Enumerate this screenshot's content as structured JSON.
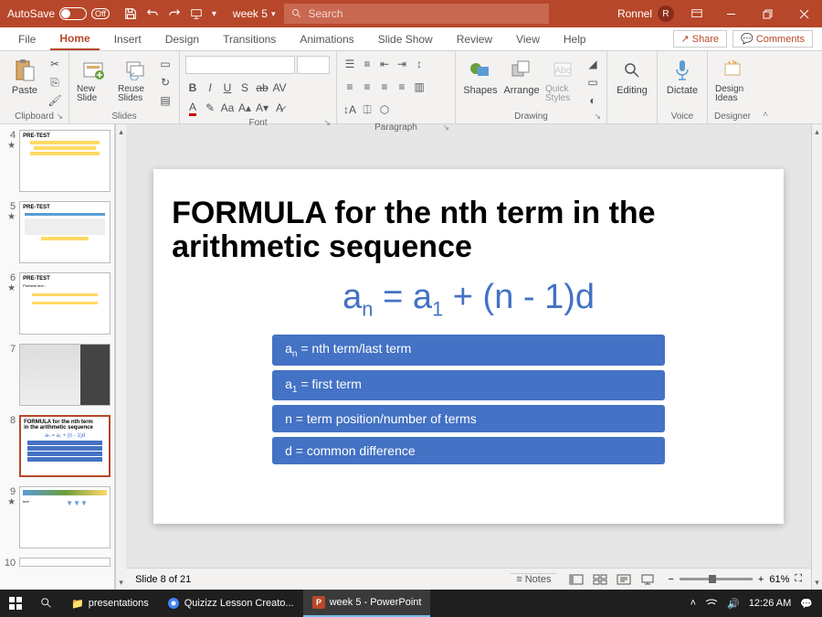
{
  "titlebar": {
    "autosave_label": "AutoSave",
    "autosave_state": "Off",
    "doc_title": "week 5",
    "search_placeholder": "Search",
    "user_name": "Ronnel",
    "user_initial": "R"
  },
  "tabs": {
    "file": "File",
    "home": "Home",
    "insert": "Insert",
    "design": "Design",
    "transitions": "Transitions",
    "animations": "Animations",
    "slideshow": "Slide Show",
    "review": "Review",
    "view": "View",
    "help": "Help"
  },
  "actions": {
    "share": "Share",
    "comments": "Comments"
  },
  "ribbon": {
    "clipboard": {
      "label": "Clipboard",
      "paste": "Paste"
    },
    "slides": {
      "label": "Slides",
      "new_slide": "New Slide",
      "reuse": "Reuse Slides"
    },
    "font": {
      "label": "Font"
    },
    "paragraph": {
      "label": "Paragraph"
    },
    "drawing": {
      "label": "Drawing",
      "shapes": "Shapes",
      "arrange": "Arrange",
      "quick": "Quick Styles"
    },
    "editing": {
      "label": "Editing",
      "btn": "Editing"
    },
    "voice": {
      "label": "Voice",
      "dictate": "Dictate"
    },
    "designer": {
      "label": "Designer",
      "ideas": "Design Ideas"
    }
  },
  "thumbnails": [
    {
      "num": "4",
      "starred": true
    },
    {
      "num": "5",
      "starred": true
    },
    {
      "num": "6",
      "starred": true
    },
    {
      "num": "7",
      "starred": false
    },
    {
      "num": "8",
      "starred": false,
      "selected": true
    },
    {
      "num": "9",
      "starred": true
    },
    {
      "num": "10",
      "starred": false
    }
  ],
  "slide": {
    "title": "FORMULA for the nth term in the arithmetic sequence",
    "formula_an": "a",
    "formula_n": "n",
    "formula_eq": " = ",
    "formula_a1": "a",
    "formula_1": "1",
    "formula_plus": " + (n - 1)d",
    "defs": [
      {
        "lhs": "a",
        "sub": "n",
        "rhs": " = nth term/last term"
      },
      {
        "lhs": "a",
        "sub": "1",
        "rhs": " = first term"
      },
      {
        "lhs": "n",
        "sub": "",
        "rhs": " = term position/number of terms"
      },
      {
        "lhs": "d",
        "sub": "",
        "rhs": " = common difference"
      }
    ]
  },
  "statusbar": {
    "slide_pos": "Slide 8 of 21",
    "notes": "Notes",
    "zoom": "61%"
  },
  "taskbar": {
    "folder": "presentations",
    "chrome": "Quizizz Lesson Creato...",
    "ppt": "week 5 - PowerPoint",
    "time": "12:26 AM"
  }
}
